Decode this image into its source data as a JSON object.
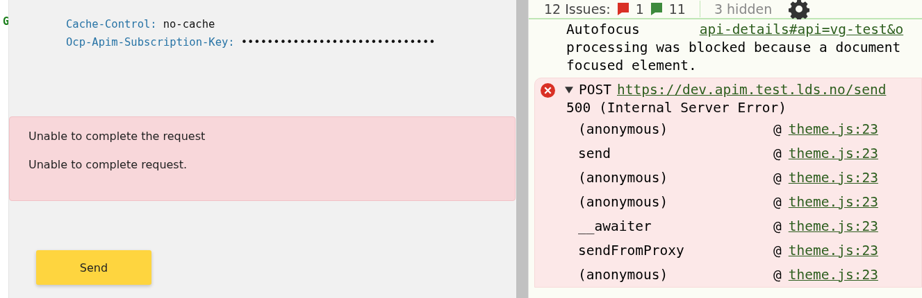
{
  "left_panel": {
    "edge_letter": "G",
    "headers": [
      {
        "name": "Cache-Control",
        "separator": ":",
        "value": "no-cache"
      },
      {
        "name": "Ocp-Apim-Subscription-Key",
        "separator": ":",
        "value": "••••••••••••••••••••••••••••••"
      }
    ],
    "error_alert": {
      "title": "Unable to complete the request",
      "message": "Unable to complete request."
    },
    "send_button": "Send"
  },
  "devtools": {
    "issues_bar": {
      "label": "12 Issues:",
      "error_count": "1",
      "info_count": "11",
      "hidden": "3 hidden"
    },
    "messages": [
      {
        "kind": "info",
        "text_start": "Autofocus",
        "link": "api-details#api=vg-test&o",
        "lines": [
          "processing was blocked because a document",
          "focused element."
        ]
      },
      {
        "kind": "error",
        "expanded": true,
        "method": "POST",
        "link": "https://dev.apim.test.lds.no/send",
        "status": "500 (Internal Server Error)",
        "frames": [
          {
            "function": "(anonymous)",
            "at": "@",
            "source": "theme.js:23"
          },
          {
            "function": "send",
            "at": "@",
            "source": "theme.js:23"
          },
          {
            "function": "(anonymous)",
            "at": "@",
            "source": "theme.js:23"
          },
          {
            "function": "(anonymous)",
            "at": "@",
            "source": "theme.js:23"
          },
          {
            "function": "__awaiter",
            "at": "@",
            "source": "theme.js:23"
          },
          {
            "function": "sendFromProxy",
            "at": "@",
            "source": "theme.js:23"
          },
          {
            "function": "(anonymous)",
            "at": "@",
            "source": "theme.js:23"
          }
        ]
      }
    ]
  }
}
